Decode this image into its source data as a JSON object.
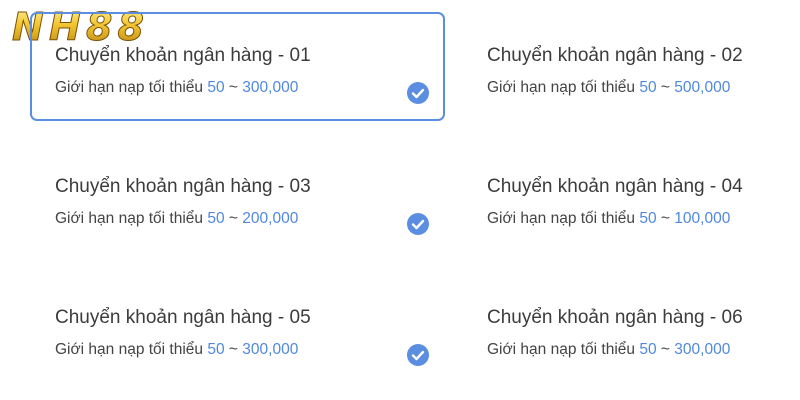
{
  "brand": {
    "logo_text": "NH88"
  },
  "colors": {
    "accent": "#4f88dd",
    "selected_border": "#5b8ee0",
    "text": "#3c3c3c",
    "logo_gold": "#e8b422"
  },
  "options": [
    {
      "title": "Chuyển khoản ngân hàng - 01",
      "limit_label": "Giới hạn nạp tối thiểu",
      "min": "50",
      "separator": "~",
      "max": "300,000",
      "selected": true
    },
    {
      "title": "Chuyển khoản ngân hàng - 02",
      "limit_label": "Giới hạn nạp tối thiểu",
      "min": "50",
      "separator": "~",
      "max": "500,000",
      "selected": false
    },
    {
      "title": "Chuyển khoản ngân hàng - 03",
      "limit_label": "Giới hạn nạp tối thiểu",
      "min": "50",
      "separator": "~",
      "max": "200,000",
      "selected": false
    },
    {
      "title": "Chuyển khoản ngân hàng - 04",
      "limit_label": "Giới hạn nạp tối thiểu",
      "min": "50",
      "separator": "~",
      "max": "100,000",
      "selected": false
    },
    {
      "title": "Chuyển khoản ngân hàng - 05",
      "limit_label": "Giới hạn nạp tối thiểu",
      "min": "50",
      "separator": "~",
      "max": "300,000",
      "selected": false
    },
    {
      "title": "Chuyển khoản ngân hàng - 06",
      "limit_label": "Giới hạn nạp tối thiểu",
      "min": "50",
      "separator": "~",
      "max": "300,000",
      "selected": false
    }
  ],
  "check_icon": "check-circle-icon"
}
